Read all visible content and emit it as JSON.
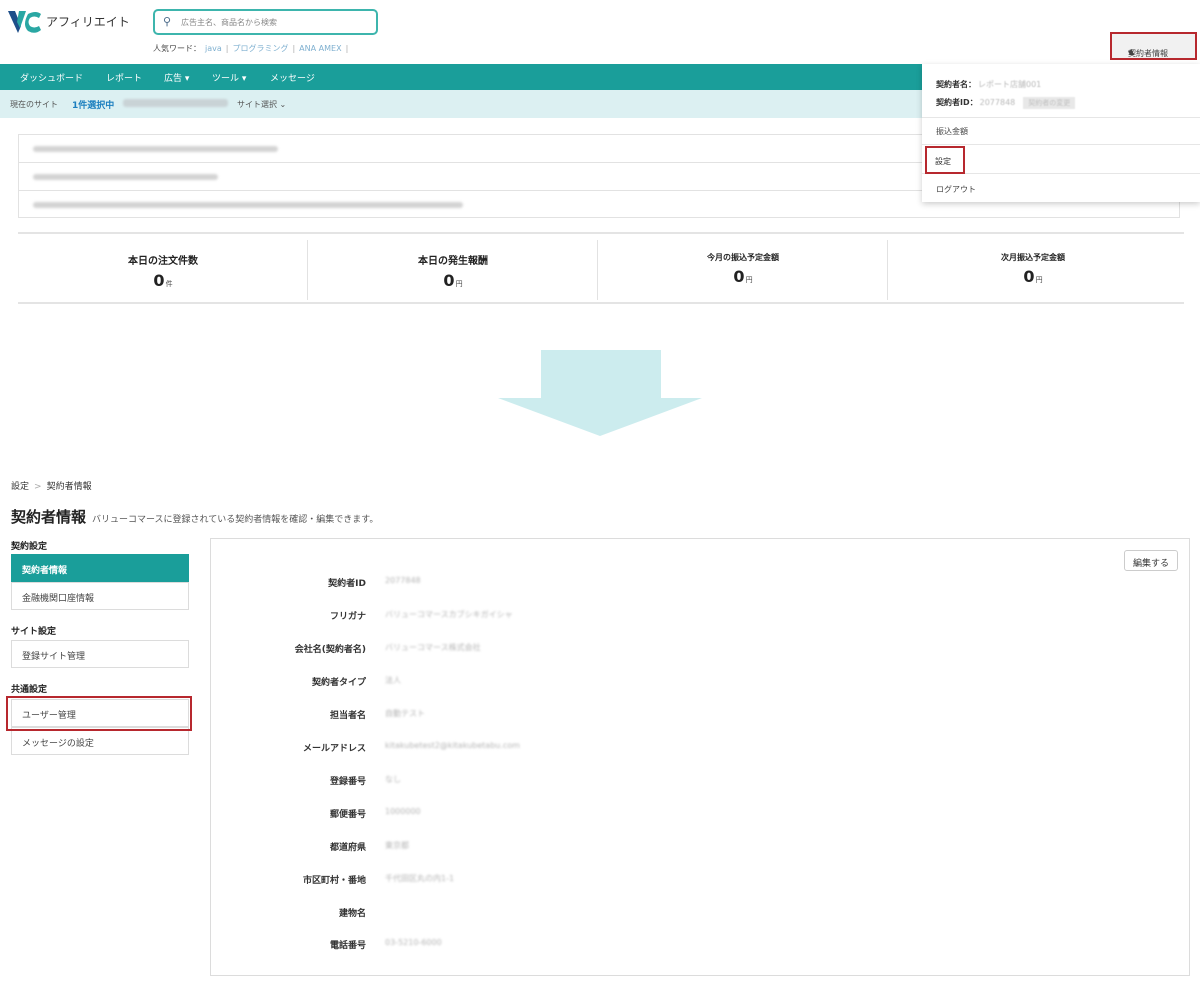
{
  "header": {
    "brand": "アフィリエイト",
    "search_placeholder": "広告主名、商品名から検索",
    "popular_label": "人気ワード：",
    "popular_words": [
      "java",
      "プログラミング",
      "ANA AMEX"
    ],
    "account_button": "契約者情報"
  },
  "nav": {
    "items": [
      "ダッシュボード",
      "レポート",
      "広告 ▾",
      "ツール ▾",
      "メッセージ"
    ]
  },
  "sitebar": {
    "label": "現在のサイト",
    "selected": "1件選択中",
    "site_select": "サイト選択 ⌄"
  },
  "stats": [
    {
      "label": "本日の注文件数",
      "value": "0",
      "unit": "件"
    },
    {
      "label": "本日の発生報酬",
      "value": "0",
      "unit": "円"
    },
    {
      "label": "今月の振込予定金額",
      "value": "0",
      "unit": "円"
    },
    {
      "label": "次月振込予定金額",
      "value": "0",
      "unit": "円"
    }
  ],
  "dropdown": {
    "name_label": "契約者名：",
    "name_value": "レポート店舗001",
    "id_label": "契約者ID：",
    "id_value": "2077848",
    "id_badge": "契約者の変更",
    "transfer": "振込金額",
    "settings": "設定",
    "logout": "ログアウト"
  },
  "bottom": {
    "breadcrumb": [
      "設定",
      "契約者情報"
    ],
    "title": "契約者情報",
    "description": "バリューコマースに登録されている契約者情報を確認・編集できます。",
    "edit_button": "編集する",
    "sidebar": {
      "contract_heading": "契約設定",
      "contract_items": [
        "契約者情報",
        "金融機関口座情報"
      ],
      "site_heading": "サイト設定",
      "site_items": [
        "登録サイト管理"
      ],
      "common_heading": "共通設定",
      "common_items": [
        "ユーザー管理",
        "メッセージの設定"
      ]
    },
    "fields": [
      {
        "label": "契約者ID",
        "value": "2077848"
      },
      {
        "label": "フリガナ",
        "value": "バリューコマースカブシキガイシャ"
      },
      {
        "label": "会社名(契約者名)",
        "value": "バリューコマース株式会社"
      },
      {
        "label": "契約者タイプ",
        "value": "法人"
      },
      {
        "label": "担当者名",
        "value": "自動テスト"
      },
      {
        "label": "メールアドレス",
        "value": "kitakubetest2@kitakubetabu.com"
      },
      {
        "label": "登録番号",
        "value": "なし"
      },
      {
        "label": "郵便番号",
        "value": "1000000"
      },
      {
        "label": "都道府県",
        "value": "東京都"
      },
      {
        "label": "市区町村・番地",
        "value": "千代田区丸の内1-1"
      },
      {
        "label": "建物名",
        "value": ""
      },
      {
        "label": "電話番号",
        "value": "03-5210-6000"
      }
    ]
  },
  "colors": {
    "teal": "#1a9e9a",
    "highlight_red": "#b7282e",
    "arrow": "#ccecee"
  }
}
